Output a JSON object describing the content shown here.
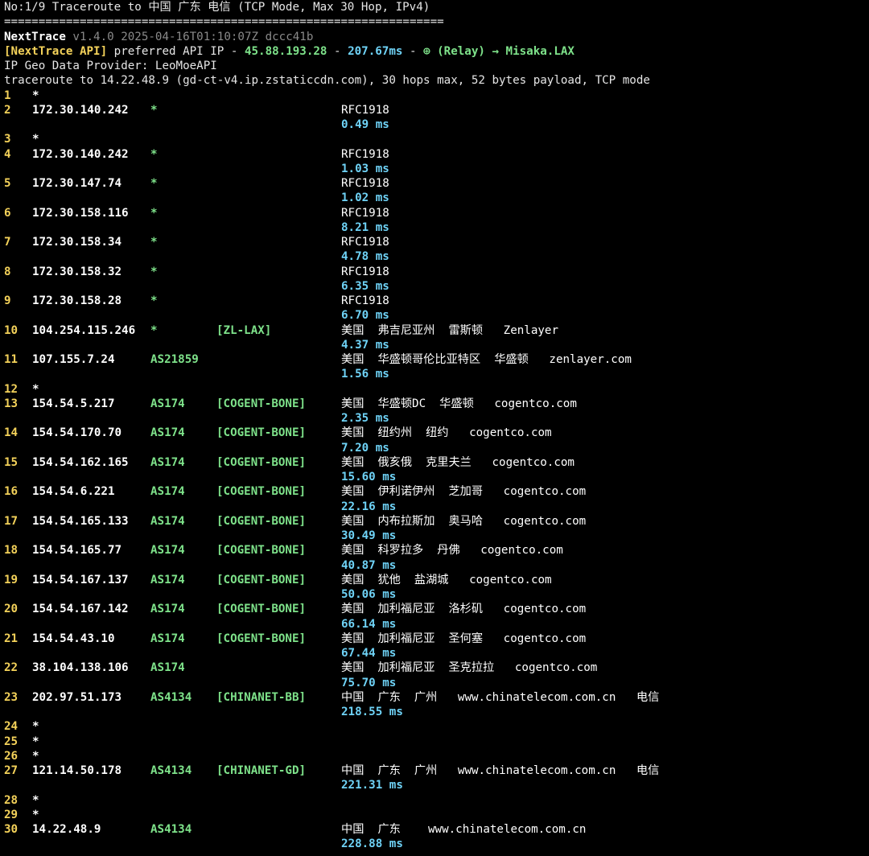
{
  "header": {
    "title": "No:1/9 Traceroute to 中国 广东 电信 (TCP Mode, Max 30 Hop, IPv4)",
    "separator": "================================================================",
    "app_name": "NextTrace",
    "app_version": "v1.4.0 2025-04-16T01:10:07Z dccc41b",
    "api_label": "[NextTrace API]",
    "api_text": " preferred API IP - ",
    "api_ip": "45.88.193.28",
    "api_dash1": " - ",
    "api_rtt": "207.67ms",
    "api_dash2": " - ",
    "api_relay": "⊕ (Relay) → Misaka.LAX",
    "geo_provider": "IP Geo Data Provider: LeoMoeAPI",
    "target_line": "traceroute to 14.22.48.9 (gd-ct-v4.ip.zstaticcdn.com), 30 hops max, 52 bytes payload, TCP mode"
  },
  "hops": [
    {
      "n": "1",
      "ip": "*"
    },
    {
      "n": "2",
      "ip": "172.30.140.242",
      "asn": "*",
      "geo": "RFC1918",
      "rtt": "0.49 ms"
    },
    {
      "n": "3",
      "ip": "*"
    },
    {
      "n": "4",
      "ip": "172.30.140.242",
      "asn": "*",
      "geo": "RFC1918",
      "rtt": "1.03 ms"
    },
    {
      "n": "5",
      "ip": "172.30.147.74",
      "asn": "*",
      "geo": "RFC1918",
      "rtt": "1.02 ms"
    },
    {
      "n": "6",
      "ip": "172.30.158.116",
      "asn": "*",
      "geo": "RFC1918",
      "rtt": "8.21 ms"
    },
    {
      "n": "7",
      "ip": "172.30.158.34",
      "asn": "*",
      "geo": "RFC1918",
      "rtt": "4.78 ms"
    },
    {
      "n": "8",
      "ip": "172.30.158.32",
      "asn": "*",
      "geo": "RFC1918",
      "rtt": "6.35 ms"
    },
    {
      "n": "9",
      "ip": "172.30.158.28",
      "asn": "*",
      "geo": "RFC1918",
      "rtt": "6.70 ms"
    },
    {
      "n": "10",
      "ip": "104.254.115.246",
      "asn": "*",
      "tag": "[ZL-LAX]",
      "geo": "美国  弗吉尼亚州  雷斯顿   Zenlayer",
      "rtt": "4.37 ms"
    },
    {
      "n": "11",
      "ip": "107.155.7.24",
      "asn": "AS21859",
      "geo": "美国  华盛顿哥伦比亚特区  华盛顿   zenlayer.com",
      "rtt": "1.56 ms"
    },
    {
      "n": "12",
      "ip": "*"
    },
    {
      "n": "13",
      "ip": "154.54.5.217",
      "asn": "AS174",
      "tag": "[COGENT-BONE]",
      "geo": "美国  华盛顿DC  华盛顿   cogentco.com",
      "rtt": "2.35 ms"
    },
    {
      "n": "14",
      "ip": "154.54.170.70",
      "asn": "AS174",
      "tag": "[COGENT-BONE]",
      "geo": "美国  纽约州  纽约   cogentco.com",
      "rtt": "7.20 ms"
    },
    {
      "n": "15",
      "ip": "154.54.162.165",
      "asn": "AS174",
      "tag": "[COGENT-BONE]",
      "geo": "美国  俄亥俄  克里夫兰   cogentco.com",
      "rtt": "15.60 ms"
    },
    {
      "n": "16",
      "ip": "154.54.6.221",
      "asn": "AS174",
      "tag": "[COGENT-BONE]",
      "geo": "美国  伊利诺伊州  芝加哥   cogentco.com",
      "rtt": "22.16 ms"
    },
    {
      "n": "17",
      "ip": "154.54.165.133",
      "asn": "AS174",
      "tag": "[COGENT-BONE]",
      "geo": "美国  内布拉斯加  奥马哈   cogentco.com",
      "rtt": "30.49 ms"
    },
    {
      "n": "18",
      "ip": "154.54.165.77",
      "asn": "AS174",
      "tag": "[COGENT-BONE]",
      "geo": "美国  科罗拉多  丹佛   cogentco.com",
      "rtt": "40.87 ms"
    },
    {
      "n": "19",
      "ip": "154.54.167.137",
      "asn": "AS174",
      "tag": "[COGENT-BONE]",
      "geo": "美国  犹他  盐湖城   cogentco.com",
      "rtt": "50.06 ms"
    },
    {
      "n": "20",
      "ip": "154.54.167.142",
      "asn": "AS174",
      "tag": "[COGENT-BONE]",
      "geo": "美国  加利福尼亚  洛杉矶   cogentco.com",
      "rtt": "66.14 ms"
    },
    {
      "n": "21",
      "ip": "154.54.43.10",
      "asn": "AS174",
      "tag": "[COGENT-BONE]",
      "geo": "美国  加利福尼亚  圣何塞   cogentco.com",
      "rtt": "67.44 ms"
    },
    {
      "n": "22",
      "ip": "38.104.138.106",
      "asn": "AS174",
      "geo": "美国  加利福尼亚  圣克拉拉   cogentco.com",
      "rtt": "75.70 ms"
    },
    {
      "n": "23",
      "ip": "202.97.51.173",
      "asn": "AS4134",
      "tag": "[CHINANET-BB]",
      "geo": "中国  广东  广州   www.chinatelecom.com.cn   电信",
      "rtt": "218.55 ms"
    },
    {
      "n": "24",
      "ip": "*"
    },
    {
      "n": "25",
      "ip": "*"
    },
    {
      "n": "26",
      "ip": "*"
    },
    {
      "n": "27",
      "ip": "121.14.50.178",
      "asn": "AS4134",
      "tag": "[CHINANET-GD]",
      "geo": "中国  广东  广州   www.chinatelecom.com.cn   电信",
      "rtt": "221.31 ms"
    },
    {
      "n": "28",
      "ip": "*"
    },
    {
      "n": "29",
      "ip": "*"
    },
    {
      "n": "30",
      "ip": "14.22.48.9",
      "asn": "AS4134",
      "geo": "中国  广东    www.chinatelecom.com.cn",
      "rtt": "228.88 ms"
    }
  ]
}
